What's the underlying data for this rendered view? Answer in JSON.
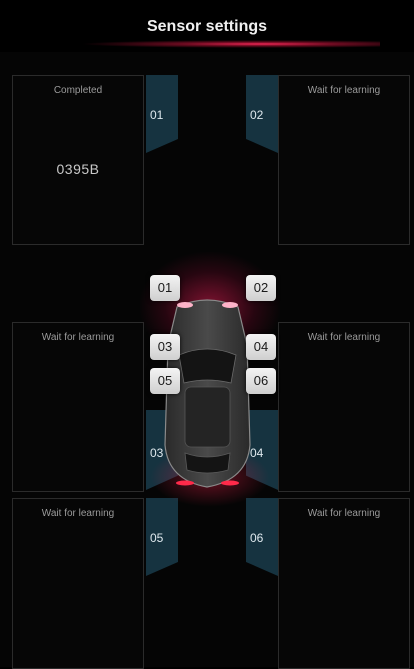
{
  "header": {
    "title": "Sensor settings"
  },
  "panels": [
    {
      "status": "Completed",
      "sensor_id": "0395B"
    },
    {
      "status": "Wait for learning",
      "sensor_id": ""
    },
    {
      "status": "Wait for learning",
      "sensor_id": ""
    },
    {
      "status": "Wait for learning",
      "sensor_id": ""
    },
    {
      "status": "Wait for learning",
      "sensor_id": ""
    },
    {
      "status": "Wait for learning",
      "sensor_id": ""
    }
  ],
  "tabs": [
    "01",
    "02",
    "03",
    "04",
    "05",
    "06"
  ],
  "car_tags": [
    "01",
    "02",
    "03",
    "04",
    "05",
    "06"
  ],
  "colors": {
    "accent_glow": "#e81e5a",
    "tab_bg": "#163340",
    "background": "#000000"
  }
}
